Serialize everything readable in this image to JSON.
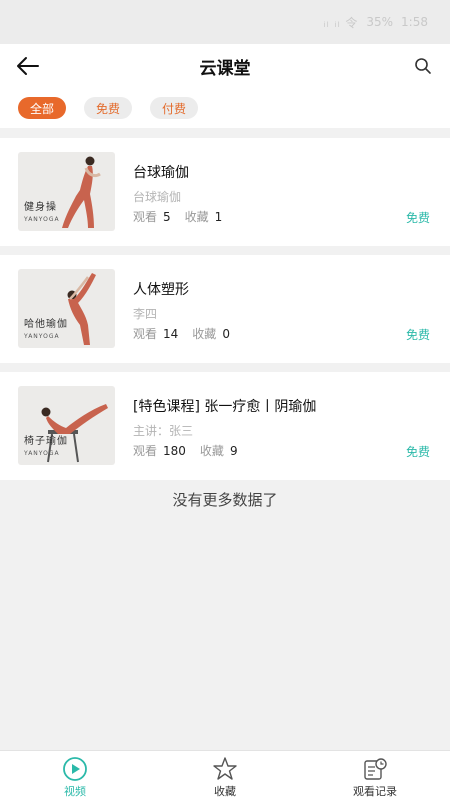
{
  "status": {
    "signal": "ᵢₗ ᵢₗ 令",
    "battery": "35%",
    "time": "1:58"
  },
  "header": {
    "title": "云课堂"
  },
  "filters": [
    {
      "label": "全部",
      "active": true
    },
    {
      "label": "免费",
      "active": false
    },
    {
      "label": "付费",
      "active": false
    }
  ],
  "courses": [
    {
      "title": "台球瑜伽",
      "subtitle": "台球瑜伽",
      "views_label": "观看",
      "views": "5",
      "fav_label": "收藏",
      "favs": "1",
      "price": "免费",
      "thumb_label": "健身操",
      "thumb_sub": "YANYOGA"
    },
    {
      "title": "人体塑形",
      "subtitle": "李四",
      "views_label": "观看",
      "views": "14",
      "fav_label": "收藏",
      "favs": "0",
      "price": "免费",
      "thumb_label": "哈他瑜伽",
      "thumb_sub": "YANYOGA"
    },
    {
      "title": "[特色课程] 张一疗愈丨阴瑜伽",
      "subtitle": "主讲：张三",
      "views_label": "观看",
      "views": "180",
      "fav_label": "收藏",
      "favs": "9",
      "price": "免费",
      "thumb_label": "椅子瑜伽",
      "thumb_sub": "YANYOGA"
    }
  ],
  "no_more": "没有更多数据了",
  "tabs": [
    {
      "label": "视频",
      "icon": "play-circle-icon",
      "active": true
    },
    {
      "label": "收藏",
      "icon": "star-icon",
      "active": false
    },
    {
      "label": "观看记录",
      "icon": "history-icon",
      "active": false
    }
  ],
  "colors": {
    "accent": "#e8692b",
    "free": "#2bb9a9"
  }
}
